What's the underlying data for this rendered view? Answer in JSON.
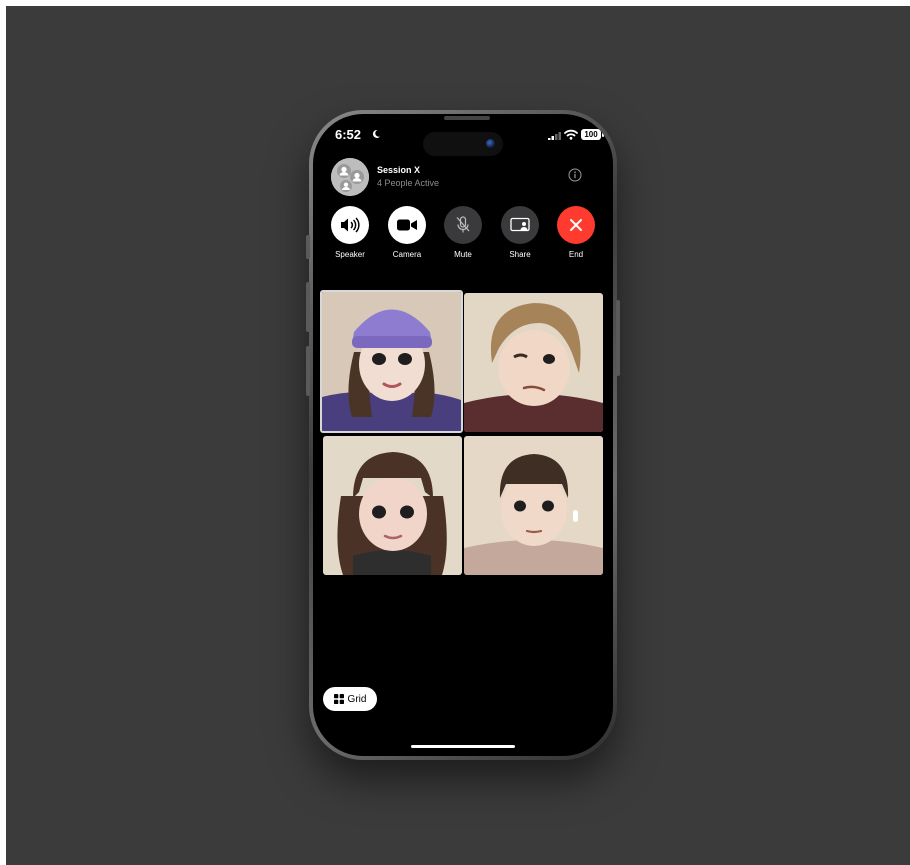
{
  "status_bar": {
    "time": "6:52",
    "battery": "100"
  },
  "session": {
    "title": "Session X",
    "subtitle": "4 People Active"
  },
  "controls": [
    {
      "label": "Speaker",
      "icon": "speaker-icon"
    },
    {
      "label": "Camera",
      "icon": "video-camera-icon"
    },
    {
      "label": "Mute",
      "icon": "mic-off-icon"
    },
    {
      "label": "Share",
      "icon": "screen-share-icon"
    },
    {
      "label": "End",
      "icon": "close-icon"
    }
  ],
  "participants": [
    {
      "avatar": "memoji-girl-purple-beanie",
      "active": true
    },
    {
      "avatar": "memoji-boy-brown-hair-winking"
    },
    {
      "avatar": "memoji-girl-bangs-dark-hair"
    },
    {
      "avatar": "memoji-boy-bowl-cut-airpods"
    }
  ],
  "grid_button": {
    "label": "Grid",
    "icon": "grid-icon"
  },
  "colors": {
    "end_call": "#ff3b30",
    "control_dark": "#3a3a3c",
    "screen": "#000000"
  }
}
